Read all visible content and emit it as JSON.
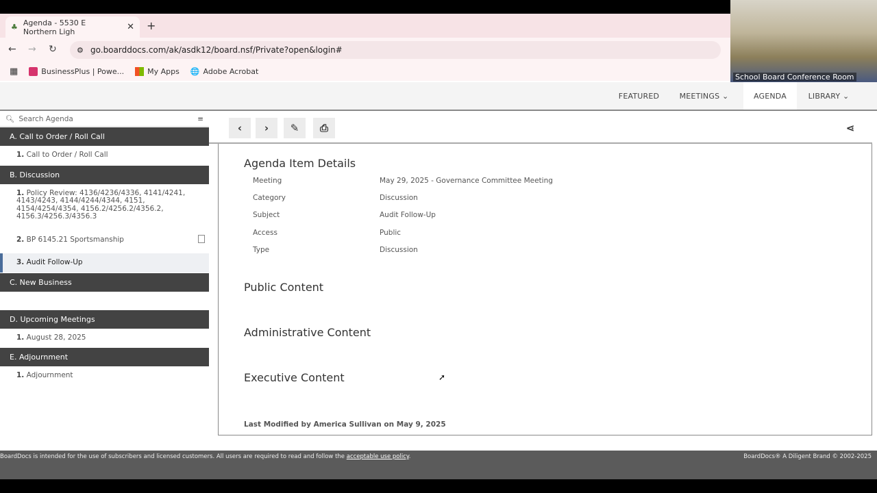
{
  "browser": {
    "tab_title": "Agenda - 5530 E Northern Ligh",
    "url": "go.boarddocs.com/ak/asdk12/board.nsf/Private?open&login#",
    "bookmarks": [
      {
        "label": "BusinessPlus | Powe...",
        "color": "#d6336c"
      },
      {
        "label": "My Apps",
        "color": "#f4a000"
      },
      {
        "label": "Adobe Acrobat",
        "color": "#333333"
      }
    ]
  },
  "video": {
    "caption": "School Board Conference Room"
  },
  "topnav": {
    "items": [
      "FEATURED",
      "MEETINGS",
      "AGENDA",
      "LIBRARY"
    ],
    "active": "AGENDA"
  },
  "sidebar": {
    "search_placeholder": "Search Agenda",
    "sections": [
      {
        "title": "A. Call to Order / Roll Call",
        "items": [
          {
            "num": "1.",
            "label": "Call to Order / Roll Call"
          }
        ]
      },
      {
        "title": "B. Discussion",
        "items": [
          {
            "num": "1.",
            "label": "Policy Review: 4136/4236/4336, 4141/4241, 4143/4243, 4144/4244/4344, 4151, 4154/4254/4354, 4156.2/4256.2/4356.2, 4156.3/4256.3/4356.3"
          },
          {
            "num": "2.",
            "label": "BP 6145.21 Sportsmanship",
            "has_doc": true
          },
          {
            "num": "3.",
            "label": "Audit Follow-Up",
            "selected": true
          }
        ]
      },
      {
        "title": "C. New Business",
        "items": []
      },
      {
        "title": "D. Upcoming Meetings",
        "items": [
          {
            "num": "1.",
            "label": "August 28, 2025"
          }
        ]
      },
      {
        "title": "E. Adjournment",
        "items": [
          {
            "num": "1.",
            "label": "Adjournment"
          }
        ]
      }
    ]
  },
  "details": {
    "title": "Agenda Item Details",
    "rows": [
      {
        "k": "Meeting",
        "v": "May 29, 2025 - Governance Committee Meeting"
      },
      {
        "k": "Category",
        "v": "Discussion"
      },
      {
        "k": "Subject",
        "v": "Audit Follow-Up"
      },
      {
        "k": "Access",
        "v": "Public"
      },
      {
        "k": "Type",
        "v": "Discussion"
      }
    ],
    "public": "Public Content",
    "admin": "Administrative Content",
    "exec": "Executive Content",
    "last_modified": "Last Modified by America Sullivan on May 9, 2025"
  },
  "footer": {
    "text": "BoardDocs is intended for the use of subscribers and licensed customers. All users are required to read and follow the",
    "link": "acceptable use policy",
    "right": "BoardDocs® A Diligent Brand © 2002-2025"
  }
}
